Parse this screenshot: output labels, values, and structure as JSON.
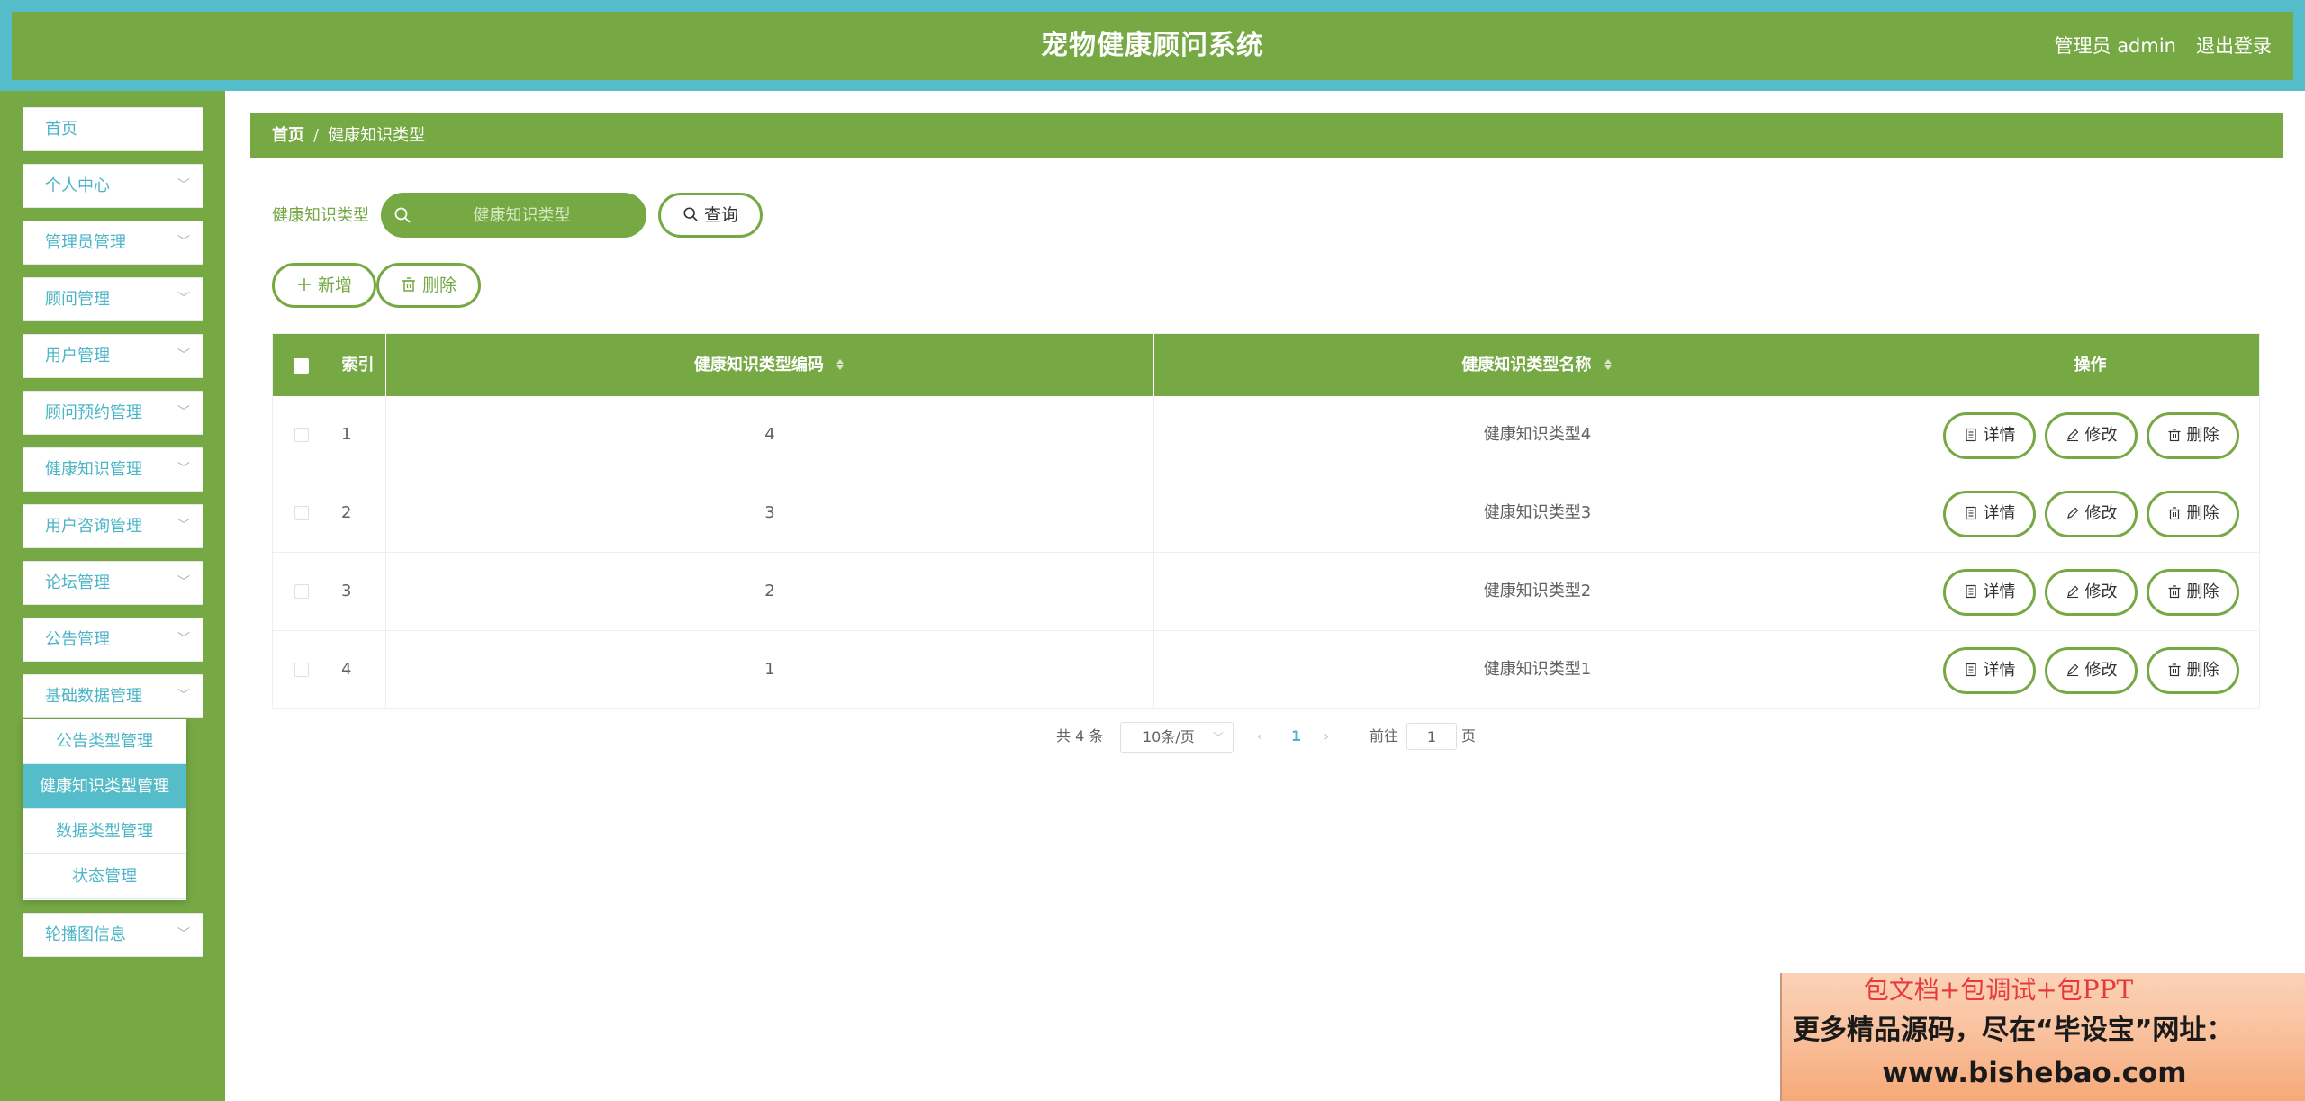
{
  "header": {
    "title": "宠物健康顾问系统",
    "user_label": "管理员 admin",
    "logout_label": "退出登录"
  },
  "sidebar": {
    "items": [
      {
        "label": "首页",
        "has_arrow": false
      },
      {
        "label": "个人中心",
        "has_arrow": true
      },
      {
        "label": "管理员管理",
        "has_arrow": true
      },
      {
        "label": "顾问管理",
        "has_arrow": true
      },
      {
        "label": "用户管理",
        "has_arrow": true
      },
      {
        "label": "顾问预约管理",
        "has_arrow": true
      },
      {
        "label": "健康知识管理",
        "has_arrow": true
      },
      {
        "label": "用户咨询管理",
        "has_arrow": true
      },
      {
        "label": "论坛管理",
        "has_arrow": true
      },
      {
        "label": "公告管理",
        "has_arrow": true
      },
      {
        "label": "基础数据管理",
        "has_arrow": true
      },
      {
        "label": "轮播图信息",
        "has_arrow": true
      }
    ],
    "submenu": [
      {
        "label": "公告类型管理",
        "active": false
      },
      {
        "label": "健康知识类型管理",
        "active": true
      },
      {
        "label": "数据类型管理",
        "active": false
      },
      {
        "label": "状态管理",
        "active": false
      }
    ]
  },
  "breadcrumb": {
    "home": "首页",
    "separator": "/",
    "current": "健康知识类型"
  },
  "search": {
    "label": "健康知识类型",
    "placeholder": "健康知识类型",
    "value": "",
    "query_button": "查询"
  },
  "toolbar": {
    "add_button": "新增",
    "delete_button": "删除"
  },
  "table": {
    "columns": [
      "索引",
      "健康知识类型编码",
      "健康知识类型名称",
      "操作"
    ],
    "rows": [
      {
        "index": "1",
        "code": "4",
        "name": "健康知识类型4"
      },
      {
        "index": "2",
        "code": "3",
        "name": "健康知识类型3"
      },
      {
        "index": "3",
        "code": "2",
        "name": "健康知识类型2"
      },
      {
        "index": "4",
        "code": "1",
        "name": "健康知识类型1"
      }
    ],
    "actions": {
      "detail": "详情",
      "edit": "修改",
      "delete": "删除"
    }
  },
  "pagination": {
    "total_text": "共 4 条",
    "page_size": "10条/页",
    "current_page": "1",
    "goto_label": "前往",
    "goto_value": "1",
    "page_suffix": "页"
  },
  "ad_banner": {
    "line1": "包文档+包调试+包PPT",
    "line2": "更多精品源码，尽在“毕设宝”网址：",
    "line3": "www.bishebao.com"
  },
  "colors": {
    "primary_green": "#76a844",
    "accent_teal": "#55bdc9",
    "menu_text": "#4cb5c7"
  }
}
